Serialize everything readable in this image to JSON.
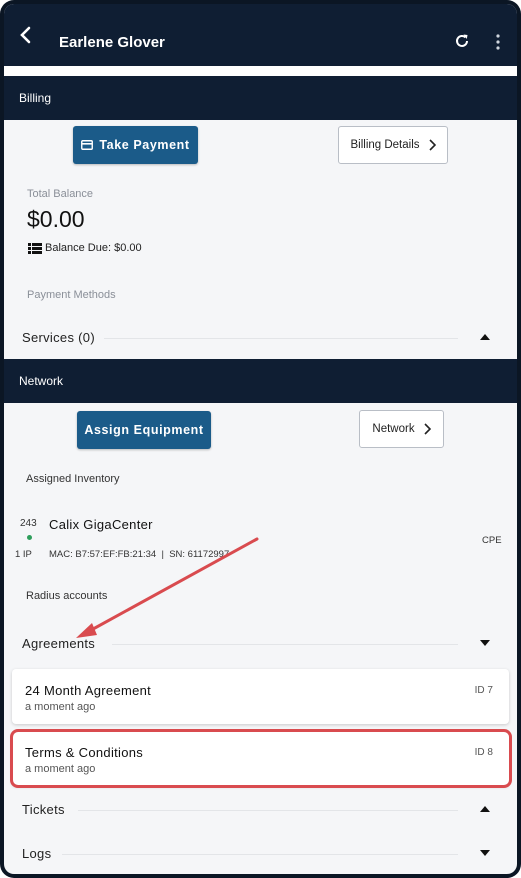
{
  "header": {
    "title": "Earlene Glover"
  },
  "billing": {
    "section_title": "Billing",
    "take_payment_label": "Take Payment",
    "billing_details_label": "Billing Details",
    "total_balance_label": "Total Balance",
    "total_balance_value": "$0.00",
    "balance_due_text": "Balance Due: $0.00",
    "payment_methods_label": "Payment Methods",
    "services_label": "Services (0)"
  },
  "network": {
    "section_title": "Network",
    "assign_equipment_label": "Assign Equipment",
    "network_button_label": "Network",
    "assigned_inventory_label": "Assigned Inventory",
    "equipment": {
      "number": "243",
      "ip_count": "1 IP",
      "name": "Calix GigaCenter",
      "details": "MAC: B7:57:EF:FB:21:34  |  SN: 61172997",
      "type": "CPE",
      "status_color": "#2e9e5b"
    },
    "radius_label": "Radius accounts"
  },
  "agreements": {
    "label": "Agreements",
    "items": [
      {
        "name": "24 Month Agreement",
        "time": "a moment ago",
        "id": "ID 7"
      },
      {
        "name": "Terms & Conditions",
        "time": "a moment ago",
        "id": "ID 8"
      }
    ]
  },
  "tickets_label": "Tickets",
  "logs_label": "Logs",
  "colors": {
    "header_bg": "#0f1e33",
    "primary_button": "#1b5b89",
    "annotation_red": "#d94b4f"
  }
}
